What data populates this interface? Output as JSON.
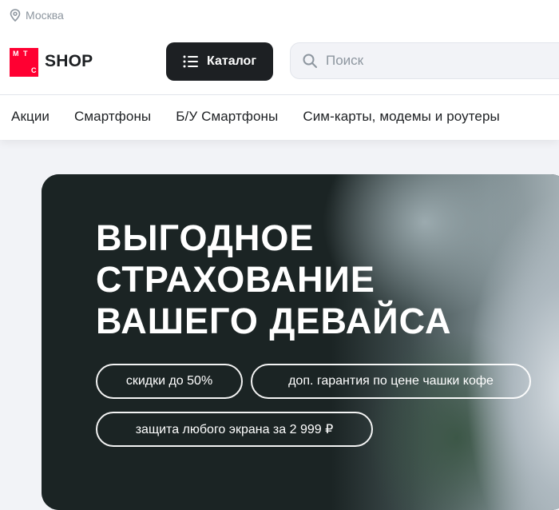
{
  "header": {
    "city": "Москва",
    "logo": {
      "letters": [
        "М",
        "Т",
        "С"
      ],
      "brand_color": "#ff0032"
    },
    "shop_label": "SHOP",
    "catalog_label": "Каталог",
    "search": {
      "placeholder": "Поиск",
      "value": ""
    },
    "icons": {
      "location": "location-pin-icon",
      "catalog": "menu-list-icon",
      "search": "search-icon"
    }
  },
  "nav": {
    "items": [
      {
        "label": "Акции"
      },
      {
        "label": "Смартфоны"
      },
      {
        "label": "Б/У Смартфоны"
      },
      {
        "label": "Сим-карты, модемы и роутеры"
      }
    ]
  },
  "banner": {
    "title_lines": [
      "ВЫГОДНОЕ",
      "СТРАХОВАНИЕ",
      "ВАШЕГО ДЕВАЙСА"
    ],
    "pills": [
      {
        "label": "скидки до 50%"
      },
      {
        "label": "доп. гарантия по цене чашки кофе"
      },
      {
        "label": "защита любого экрана за 2 999 ₽"
      }
    ],
    "background_color": "#1b2424"
  },
  "colors": {
    "accent": "#ff0032",
    "dark": "#1d2023",
    "muted": "#8d969f",
    "page_bg": "#f2f3f7"
  }
}
